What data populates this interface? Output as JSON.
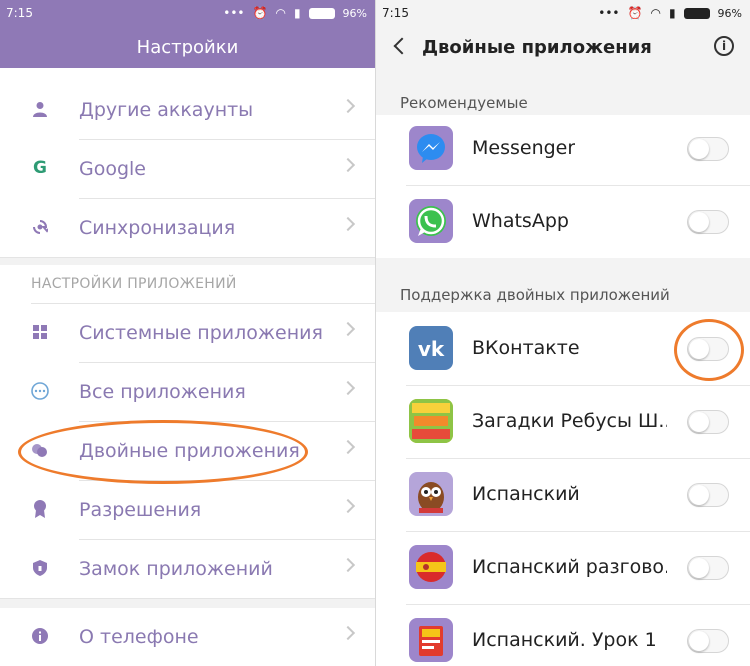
{
  "left": {
    "status": {
      "time": "7:15",
      "battery": "96%"
    },
    "title": "Настройки",
    "accounts": [
      {
        "label": "Другие аккаунты",
        "icon": "person-icon"
      },
      {
        "label": "Google",
        "icon": "google-icon"
      },
      {
        "label": "Синхронизация",
        "icon": "sync-icon"
      }
    ],
    "section_title": "НАСТРОЙКИ ПРИЛОЖЕНИЙ",
    "apps": [
      {
        "label": "Системные приложения",
        "icon": "grid-icon"
      },
      {
        "label": "Все приложения",
        "icon": "dots-icon"
      },
      {
        "label": "Двойные приложения",
        "icon": "dual-icon"
      },
      {
        "label": "Разрешения",
        "icon": "badge-icon"
      },
      {
        "label": "Замок приложений",
        "icon": "shield-icon"
      }
    ],
    "about": {
      "label": "О телефоне",
      "icon": "info-icon"
    }
  },
  "right": {
    "status": {
      "time": "7:15",
      "battery": "96%"
    },
    "title": "Двойные приложения",
    "recommended_title": "Рекомендуемые",
    "recommended": [
      {
        "name": "Messenger",
        "icon": "messenger-icon",
        "enabled": false
      },
      {
        "name": "WhatsApp",
        "icon": "whatsapp-icon",
        "enabled": false
      }
    ],
    "support_title": "Поддержка двойных приложений",
    "supported": [
      {
        "name": "ВКонтакте",
        "icon": "vk-icon",
        "enabled": false
      },
      {
        "name": "Загадки Ребусы Ш...",
        "icon": "riddles-icon",
        "enabled": false
      },
      {
        "name": "Испанский",
        "icon": "owl-icon",
        "enabled": false
      },
      {
        "name": "Испанский разгово...",
        "icon": "spain-flag-icon",
        "enabled": false
      },
      {
        "name": "Испанский. Урок 1",
        "icon": "book-icon",
        "enabled": false
      }
    ]
  },
  "colors": {
    "accent": "#8f79b6",
    "highlight": "#ee7b2c"
  }
}
